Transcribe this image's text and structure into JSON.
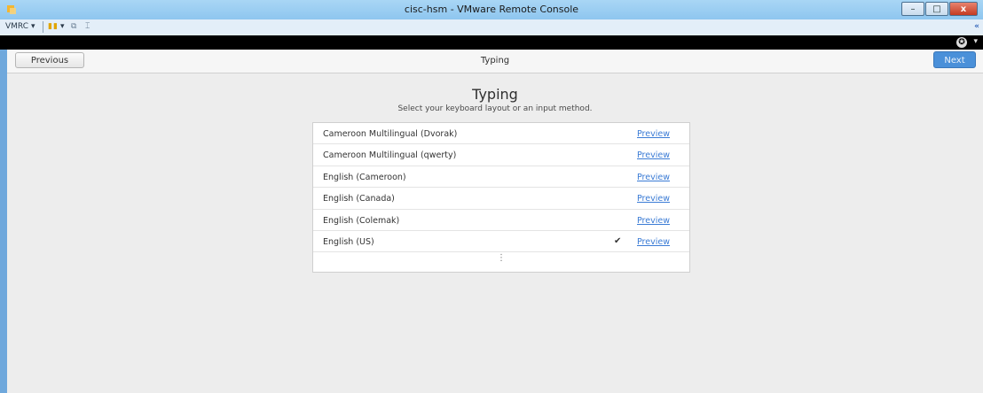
{
  "window": {
    "title": "cisc-hsm - VMware Remote Console",
    "minimize_label": "–",
    "maximize_label": "□",
    "close_label": "x"
  },
  "toolbar": {
    "vmrc_label": "VMRC",
    "vmrc_dropdown": "▾",
    "pause_glyph": "▮▮",
    "pause_dropdown": "▾",
    "network_glyph": "⧉",
    "fit_glyph": "⌶",
    "collapse_glyph": "«"
  },
  "guest_topbar": {
    "accessibility_glyph": "✪",
    "dropdown_glyph": "▾"
  },
  "header": {
    "previous_label": "Previous",
    "title": "Typing",
    "next_label": "Next"
  },
  "page": {
    "title": "Typing",
    "subtitle": "Select your keyboard layout or an input method."
  },
  "layouts": [
    {
      "name": "Cameroon Multilingual (Dvorak)",
      "preview_label": "Preview",
      "selected": false
    },
    {
      "name": "Cameroon Multilingual (qwerty)",
      "preview_label": "Preview",
      "selected": false
    },
    {
      "name": "English (Cameroon)",
      "preview_label": "Preview",
      "selected": false
    },
    {
      "name": "English (Canada)",
      "preview_label": "Preview",
      "selected": false
    },
    {
      "name": "English (Colemak)",
      "preview_label": "Preview",
      "selected": false
    },
    {
      "name": "English (US)",
      "preview_label": "Preview",
      "selected": true,
      "check_glyph": "✔"
    }
  ],
  "more_glyph": "⋮",
  "colors": {
    "accent": "#4a90d9",
    "link": "#3a7bd5",
    "pause": "#e0a400",
    "close_button": "#c43b22"
  }
}
